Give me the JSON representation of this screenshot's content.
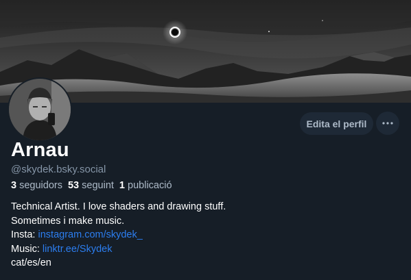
{
  "profile": {
    "display_name": "Arnau",
    "handle": "@skydek.bsky.social",
    "avatar_icon": "avatar-photo",
    "banner_icon": "mountain-eclipse-banner"
  },
  "actions": {
    "edit_label": "Edita el perfil",
    "more_icon": "ellipsis-icon"
  },
  "stats": {
    "followers_count": "3",
    "followers_label": "seguidors",
    "following_count": "53",
    "following_label": "seguint",
    "posts_count": "1",
    "posts_label": "publicació"
  },
  "bio": {
    "line1": "Technical Artist. I love shaders and drawing stuff.",
    "line2": "Sometimes i make music.",
    "insta_prefix": "Insta: ",
    "insta_link": "instagram.com/skydek_",
    "music_prefix": "Music: ",
    "music_link": "linktr.ee/Skydek",
    "line5": "cat/es/en"
  },
  "colors": {
    "background": "#161e27",
    "button_bg": "#1e2936",
    "link": "#2c7ef0",
    "muted_text": "#8595a7"
  }
}
